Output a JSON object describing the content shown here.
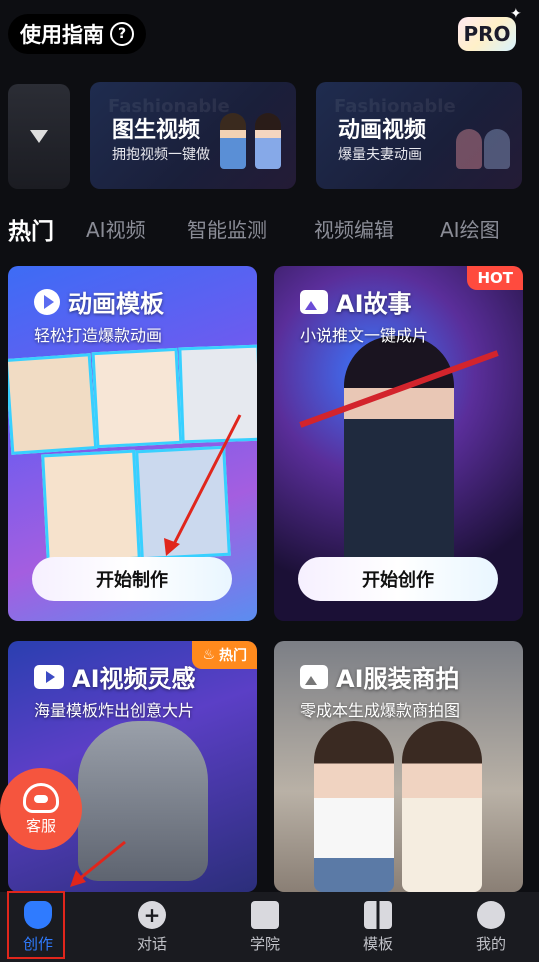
{
  "header": {
    "guide_label": "使用指南",
    "guide_icon": "question-circle-icon",
    "pro_label": "PRO"
  },
  "features": [
    {
      "title": "图生视频",
      "subtitle": "拥抱视频一键做",
      "watermark": "Fashionable"
    },
    {
      "title": "动画视频",
      "subtitle": "爆量夫妻动画",
      "watermark": "Fashionable"
    }
  ],
  "tabs": [
    "热门",
    "AI视频",
    "智能监测",
    "视频编辑",
    "AI绘图"
  ],
  "cards": [
    {
      "title": "动画模板",
      "desc": "轻松打造爆款动画",
      "cta": "开始制作"
    },
    {
      "title": "AI故事",
      "desc": "小说推文一键成片",
      "cta": "开始创作",
      "badge": "HOT"
    },
    {
      "title": "AI视频灵感",
      "desc": "海量模板炸出创意大片",
      "badge": "热门"
    },
    {
      "title": "AI服装商拍",
      "desc": "零成本生成爆款商拍图"
    }
  ],
  "customer_service": {
    "label": "客服"
  },
  "nav": [
    {
      "label": "创作",
      "icon": "create-icon"
    },
    {
      "label": "对话",
      "icon": "chat-plus-icon"
    },
    {
      "label": "学院",
      "icon": "academy-icon"
    },
    {
      "label": "模板",
      "icon": "template-icon"
    },
    {
      "label": "我的",
      "icon": "profile-icon"
    }
  ],
  "colors": {
    "accent": "#2f7bff",
    "hot": "#ff4b3e",
    "remen": "#ff8a1d",
    "service": "#f5553e"
  }
}
